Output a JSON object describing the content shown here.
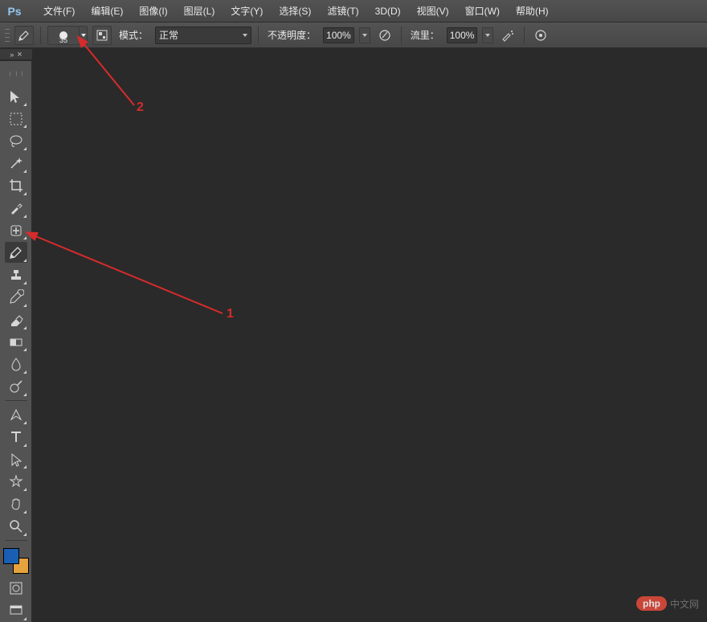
{
  "app": {
    "logo_text": "Ps"
  },
  "menu": [
    {
      "label": "文件(F)"
    },
    {
      "label": "编辑(E)"
    },
    {
      "label": "图像(I)"
    },
    {
      "label": "图层(L)"
    },
    {
      "label": "文字(Y)"
    },
    {
      "label": "选择(S)"
    },
    {
      "label": "滤镜(T)"
    },
    {
      "label": "3D(D)"
    },
    {
      "label": "视图(V)"
    },
    {
      "label": "窗口(W)"
    },
    {
      "label": "帮助(H)"
    }
  ],
  "options_bar": {
    "brush_size": "35",
    "mode_label": "模式：",
    "mode_value": "正常",
    "opacity_label": "不透明度：",
    "opacity_value": "100%",
    "flow_label": "流里：",
    "flow_value": "100%"
  },
  "tools": [
    {
      "name": "move-tool",
      "glyph": "move"
    },
    {
      "name": "marquee-tool",
      "glyph": "marquee"
    },
    {
      "name": "lasso-tool",
      "glyph": "lasso"
    },
    {
      "name": "wand-tool",
      "glyph": "wand"
    },
    {
      "name": "crop-tool",
      "glyph": "crop"
    },
    {
      "name": "eyedropper-tool",
      "glyph": "eyedropper"
    },
    {
      "name": "healing-tool",
      "glyph": "healing"
    },
    {
      "name": "brush-tool",
      "glyph": "brush",
      "active": true
    },
    {
      "name": "stamp-tool",
      "glyph": "stamp"
    },
    {
      "name": "history-brush-tool",
      "glyph": "history"
    },
    {
      "name": "eraser-tool",
      "glyph": "eraser"
    },
    {
      "name": "gradient-tool",
      "glyph": "gradient"
    },
    {
      "name": "blur-tool",
      "glyph": "blur"
    },
    {
      "name": "dodge-tool",
      "glyph": "dodge"
    },
    {
      "name": "pen-tool",
      "glyph": "pen"
    },
    {
      "name": "type-tool",
      "glyph": "type"
    },
    {
      "name": "path-select-tool",
      "glyph": "pathsel"
    },
    {
      "name": "shape-tool",
      "glyph": "shape"
    },
    {
      "name": "hand-tool",
      "glyph": "hand"
    },
    {
      "name": "zoom-tool",
      "glyph": "zoom"
    }
  ],
  "quickmask": {
    "name": "quick-mask-button"
  },
  "screenmode": {
    "name": "screen-mode-button"
  },
  "annotations": {
    "label1": "1",
    "label2": "2"
  },
  "watermark": {
    "badge": "php",
    "text": "中文网"
  }
}
